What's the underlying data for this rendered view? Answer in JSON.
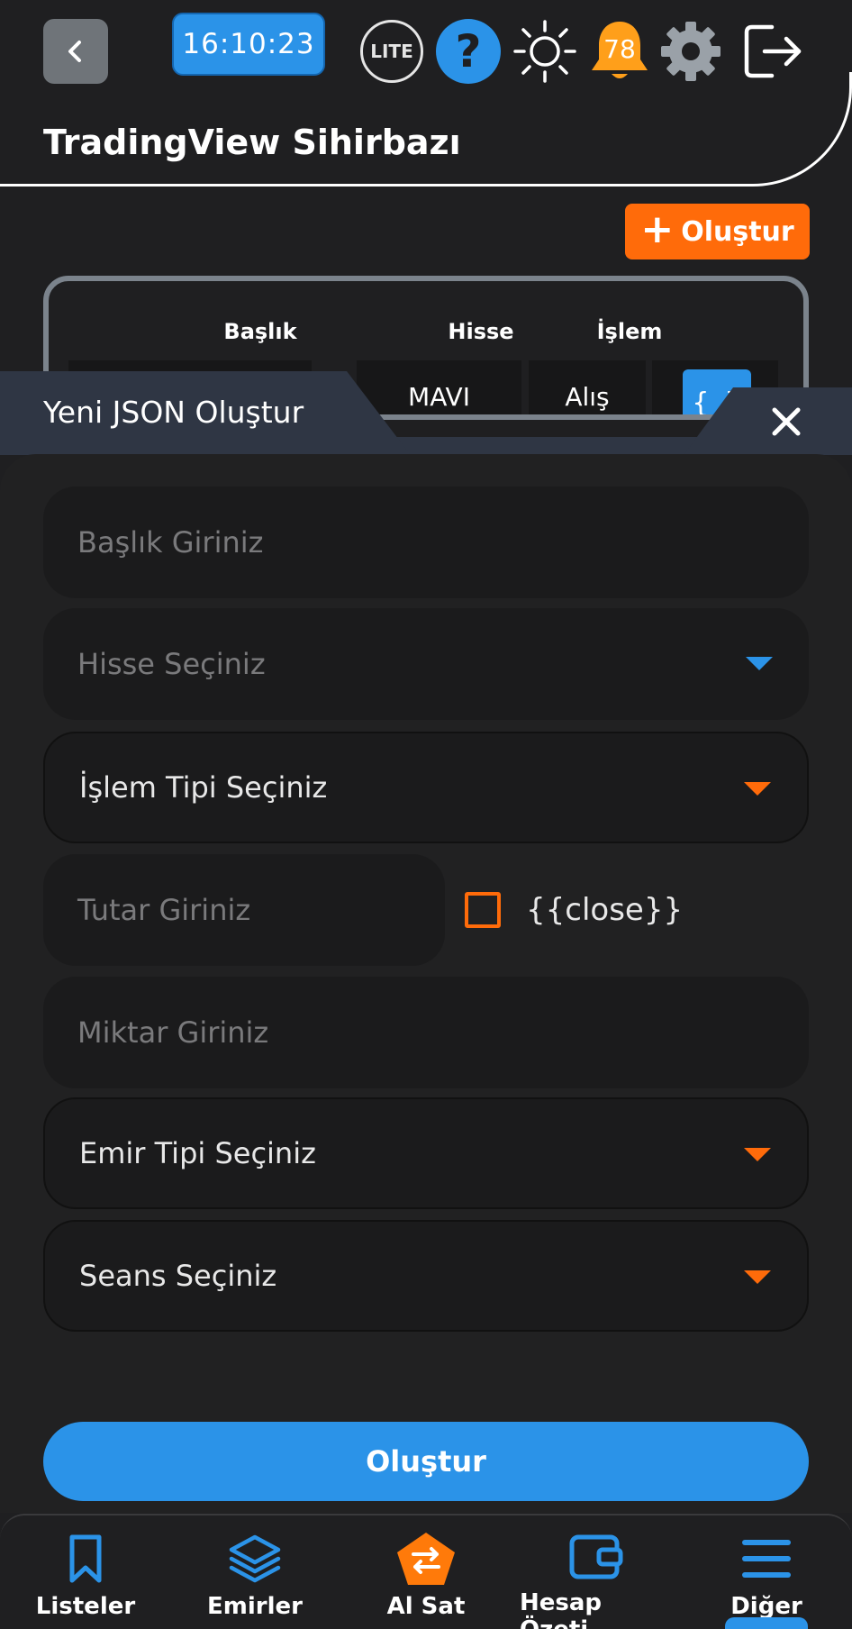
{
  "header": {
    "clock": "16:10:23",
    "lite_label": "LITE",
    "help_glyph": "?",
    "notification_count": "78",
    "title": "TradingView Sihirbazı"
  },
  "toolbar": {
    "create_label": "Oluştur"
  },
  "table": {
    "columns": [
      "Başlık",
      "Hisse",
      "İşlem"
    ],
    "row": {
      "hisse": "MAVI",
      "islem": "Alış",
      "json_glyph": "{ }"
    }
  },
  "modal": {
    "title": "Yeni JSON Oluştur",
    "fields": {
      "baslik_placeholder": "Başlık Giriniz",
      "hisse_placeholder": "Hisse Seçiniz",
      "islem_tipi": "İşlem Tipi Seçiniz",
      "tutar_placeholder": "Tutar Giriniz",
      "close_checkbox_label": "{{close}}",
      "miktar_placeholder": "Miktar Giriniz",
      "emir_tipi": "Emir Tipi Seçiniz",
      "seans": "Seans Seçiniz"
    },
    "submit_label": "Oluştur"
  },
  "bottom_nav": {
    "items": [
      {
        "label": "Listeler",
        "icon": "bookmark-icon"
      },
      {
        "label": "Emirler",
        "icon": "layers-icon"
      },
      {
        "label": "Al Sat",
        "icon": "swap-icon"
      },
      {
        "label": "Hesap Özeti",
        "icon": "wallet-icon"
      },
      {
        "label": "Diğer",
        "icon": "menu-icon"
      }
    ],
    "active": "Diğer"
  },
  "colors": {
    "background": "#1f1f21",
    "accent_blue": "#2b93e8",
    "accent_orange": "#ff6b0a",
    "modal_header": "#2f3644"
  }
}
